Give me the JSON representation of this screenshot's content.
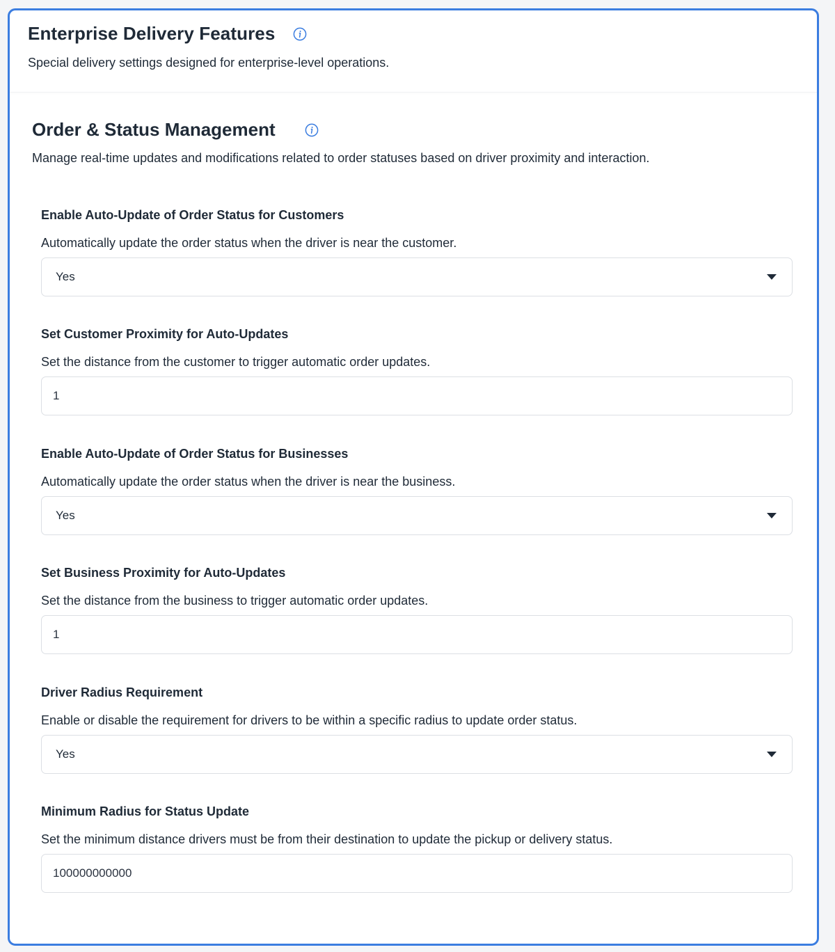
{
  "header": {
    "title": "Enterprise Delivery Features",
    "description": "Special delivery settings designed for enterprise-level operations."
  },
  "section": {
    "title": "Order & Status Management",
    "description": "Manage real-time updates and modifications related to order statuses based on driver proximity and interaction."
  },
  "fields": [
    {
      "label": "Enable Auto-Update of Order Status for Customers",
      "help": "Automatically update the order status when the driver is near the customer.",
      "type": "select",
      "value": "Yes"
    },
    {
      "label": "Set Customer Proximity for Auto-Updates",
      "help": "Set the distance from the customer to trigger automatic order updates.",
      "type": "input",
      "value": "1"
    },
    {
      "label": "Enable Auto-Update of Order Status for Businesses",
      "help": "Automatically update the order status when the driver is near the business.",
      "type": "select",
      "value": "Yes"
    },
    {
      "label": "Set Business Proximity for Auto-Updates",
      "help": "Set the distance from the business to trigger automatic order updates.",
      "type": "input",
      "value": "1"
    },
    {
      "label": "Driver Radius Requirement",
      "help": "Enable or disable the requirement for drivers to be within a specific radius to update order status.",
      "type": "select",
      "value": "Yes"
    },
    {
      "label": "Minimum Radius for Status Update",
      "help": "Set the minimum distance drivers must be from their destination to update the pickup or delivery status.",
      "type": "input",
      "value": "100000000000"
    }
  ],
  "icons": {
    "info": "info-circle-icon",
    "dropdown": "chevron-down-icon"
  },
  "colors": {
    "accent": "#3b7de0",
    "text": "#1f2a37",
    "border": "#dcdfe4"
  }
}
